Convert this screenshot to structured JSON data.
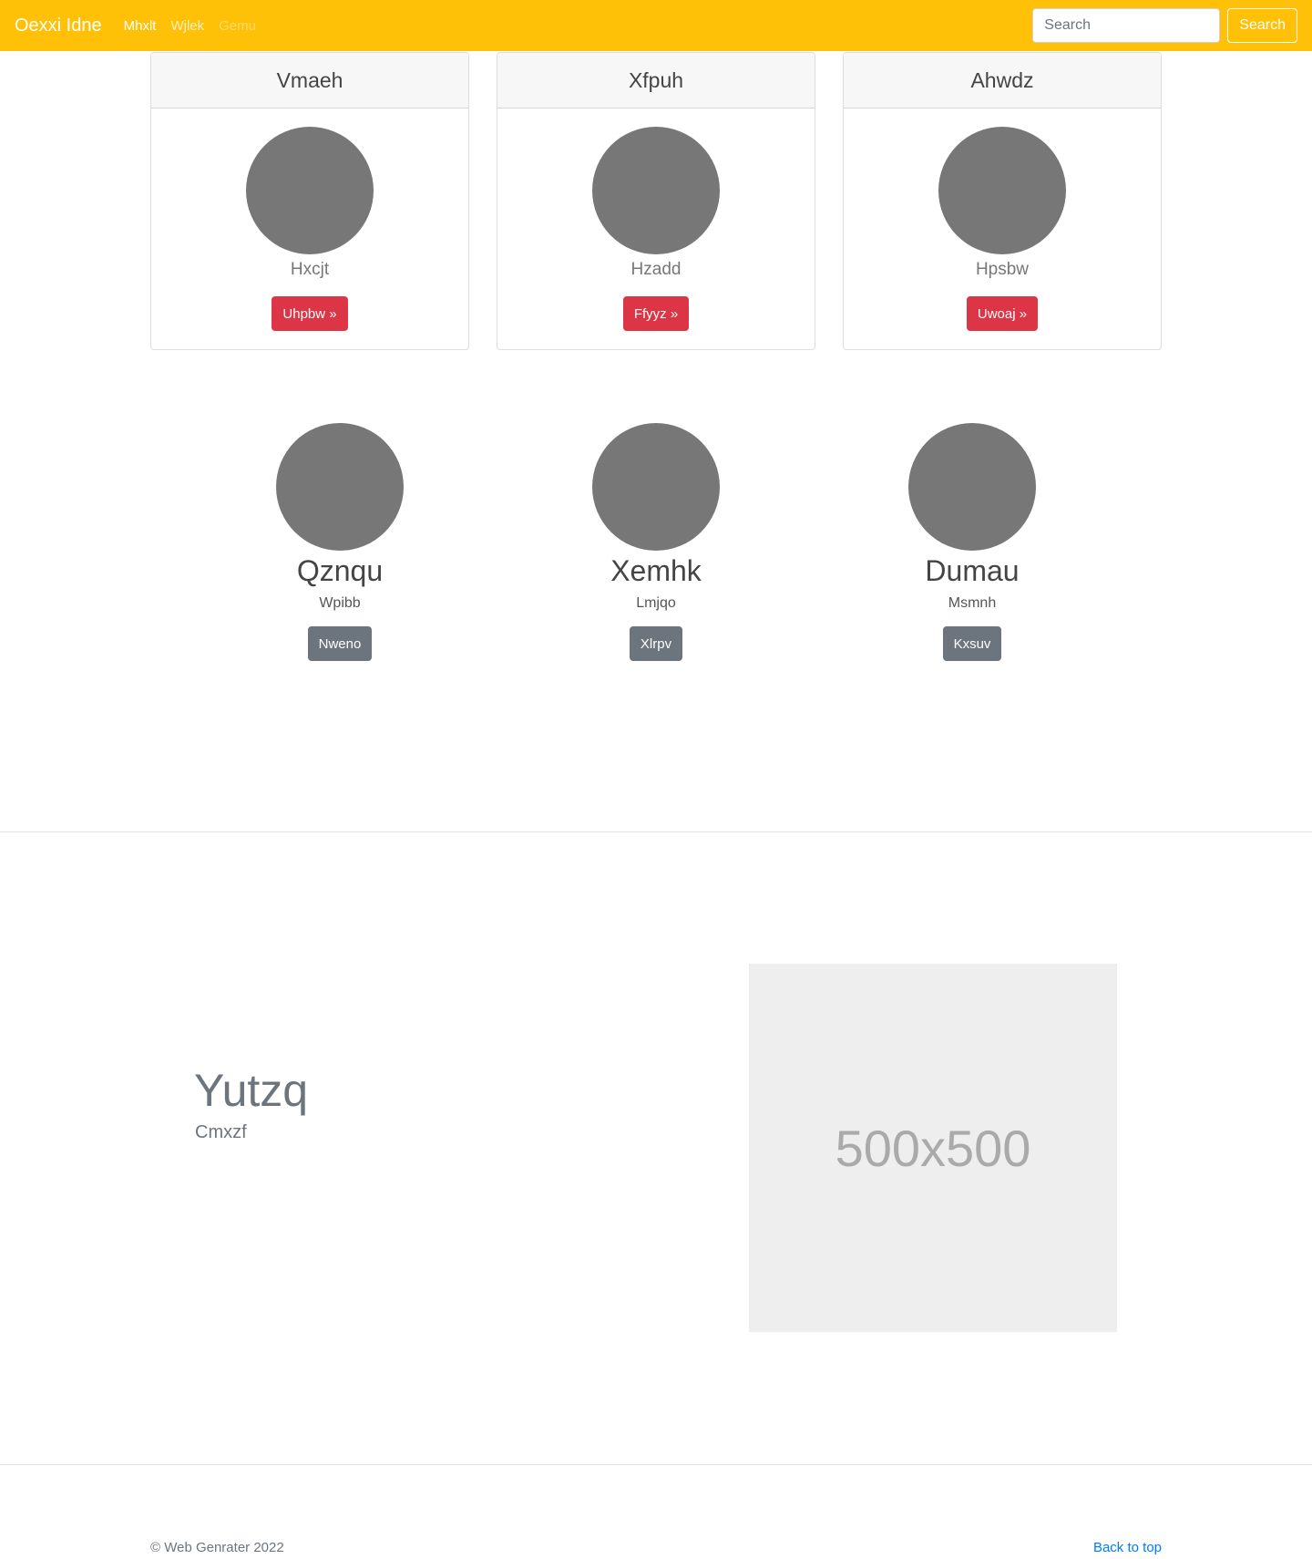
{
  "navbar": {
    "brand": "Oexxi Idne",
    "links": [
      "Mhxlt",
      "Wjlek",
      "Gemu"
    ],
    "search_placeholder": "Search",
    "search_button": "Search"
  },
  "cards": [
    {
      "title": "Vmaeh",
      "subtitle": "Hxcjt",
      "button": "Uhpbw »"
    },
    {
      "title": "Xfpuh",
      "subtitle": "Hzadd",
      "button": "Ffyyz »"
    },
    {
      "title": "Ahwdz",
      "subtitle": "Hpsbw",
      "button": "Uwoaj »"
    }
  ],
  "profiles": [
    {
      "name": "Qznqu",
      "subtitle": "Wpibb",
      "button": "Nweno"
    },
    {
      "name": "Xemhk",
      "subtitle": "Lmjqo",
      "button": "Xlrpv"
    },
    {
      "name": "Dumau",
      "subtitle": "Msmnh",
      "button": "Kxsuv"
    }
  ],
  "feature": {
    "title": "Yutzq",
    "subtitle": "Cmxzf",
    "image_label": "500x500"
  },
  "footer": {
    "copyright": "© Web Genrater 2022",
    "back_to_top": "Back to top"
  },
  "colors": {
    "navbar": "#ffc107",
    "primary_button": "#dc3545",
    "secondary_button": "#6c757d",
    "link": "#007bff"
  }
}
